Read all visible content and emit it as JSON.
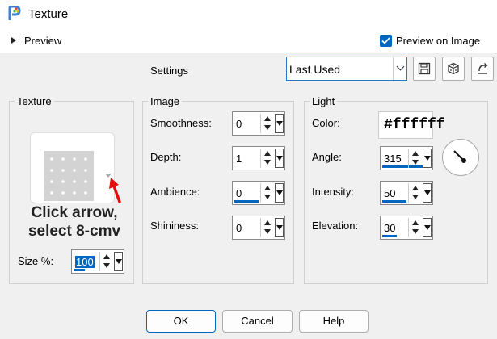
{
  "window": {
    "title": "Texture"
  },
  "preview": {
    "label": "Preview",
    "preview_on_image_label": "Preview on Image",
    "preview_on_image_checked": true
  },
  "settings": {
    "label": "Settings",
    "preset_value": "Last Used"
  },
  "texture_group": {
    "title": "Texture",
    "annotation_line1": "Click arrow,",
    "annotation_line2": "select 8-cmv",
    "size_label": "Size %:",
    "size_value": "100"
  },
  "image_group": {
    "title": "Image",
    "fields": [
      {
        "label": "Smoothness:",
        "value": "0"
      },
      {
        "label": "Depth:",
        "value": "1"
      },
      {
        "label": "Ambience:",
        "value": "0"
      },
      {
        "label": "Shininess:",
        "value": "0"
      }
    ]
  },
  "light_group": {
    "title": "Light",
    "color_label": "Color:",
    "color_value": "#ffffff",
    "fields": [
      {
        "label": "Angle:",
        "value": "315"
      },
      {
        "label": "Intensity:",
        "value": "50"
      },
      {
        "label": "Elevation:",
        "value": "30"
      }
    ]
  },
  "buttons": {
    "ok": "OK",
    "cancel": "Cancel",
    "help": "Help"
  },
  "colors": {
    "accent": "#0067c0",
    "annotation_arrow": "#e01010"
  },
  "icons": [
    "app-icon",
    "save-icon",
    "dice-icon",
    "reset-icon",
    "chevron-down-icon"
  ]
}
